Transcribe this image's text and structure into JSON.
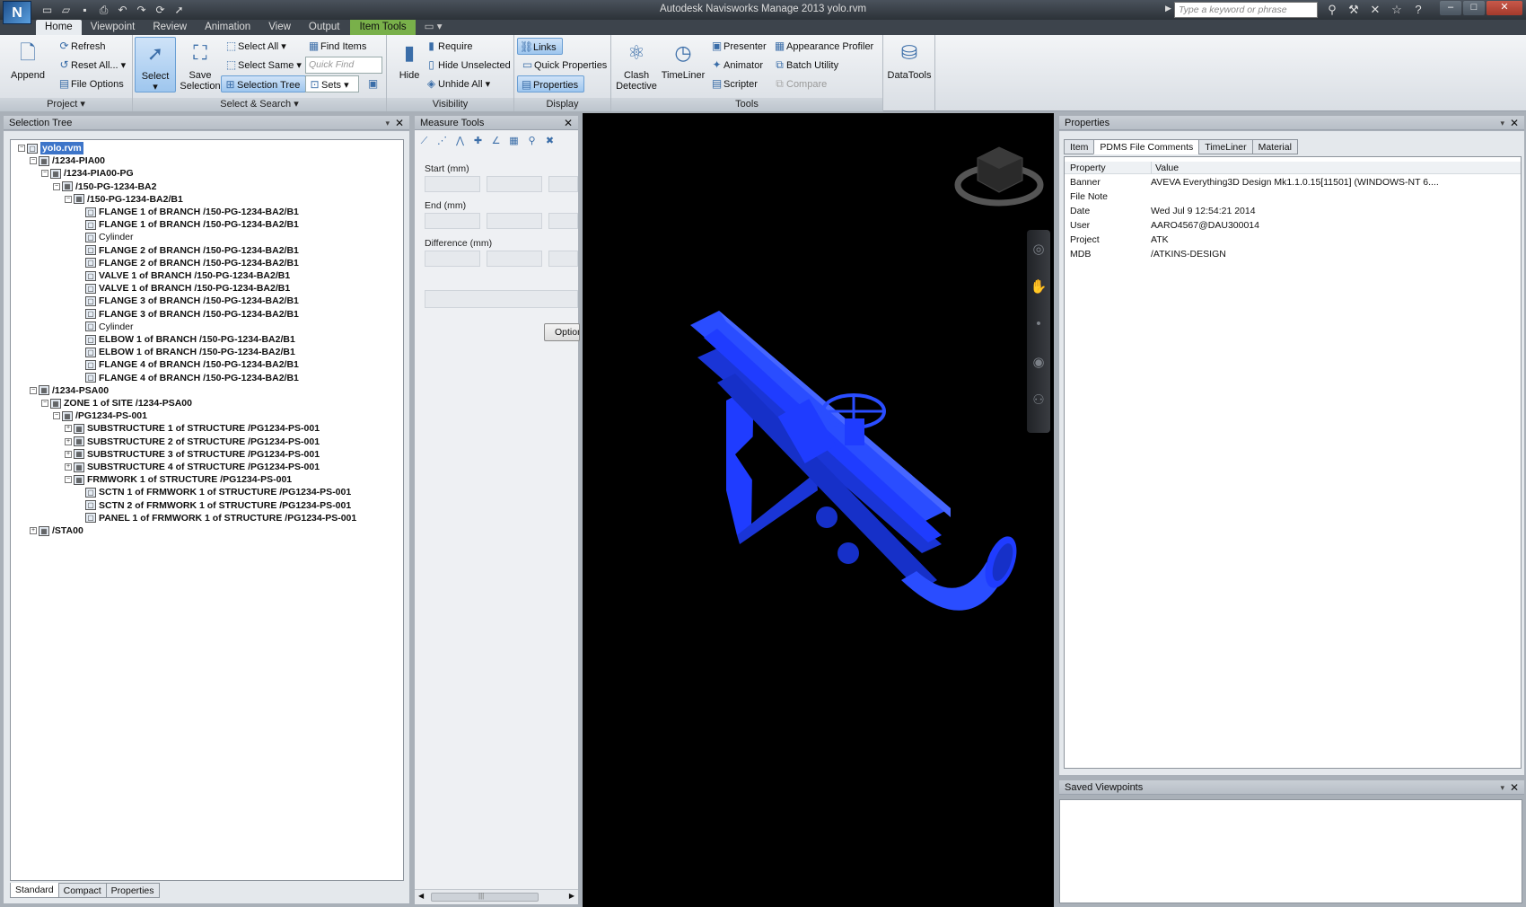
{
  "titlebar": {
    "title": "Autodesk Navisworks Manage 2013    yolo.rvm",
    "search_placeholder": "Type a keyword or phrase",
    "logo": "N",
    "quick_access_icons": [
      "new-icon",
      "open-icon",
      "save-icon",
      "print-icon",
      "undo-icon",
      "redo-icon",
      "refresh-icon",
      "select-icon"
    ],
    "window_buttons": [
      "–",
      "□",
      "✕"
    ]
  },
  "menu": {
    "tabs": [
      "Home",
      "Viewpoint",
      "Review",
      "Animation",
      "View",
      "Output",
      "Item Tools"
    ],
    "active": "Home",
    "context_tab": "Item Tools"
  },
  "ribbon": {
    "project": {
      "label": "Project",
      "append": "Append",
      "refresh": "Refresh",
      "reset_all": "Reset All...",
      "file_options": "File Options"
    },
    "select_search": {
      "label": "Select & Search",
      "select": "Select",
      "save_selection_1": "Save",
      "save_selection_2": "Selection",
      "select_all": "Select All",
      "select_same": "Select Same",
      "selection_tree": "Selection Tree",
      "find_items": "Find Items",
      "quick_find": "Quick Find",
      "sets": "Sets"
    },
    "visibility": {
      "label": "Visibility",
      "hide": "Hide",
      "require": "Require",
      "hide_unselected": "Hide Unselected",
      "unhide_all": "Unhide All"
    },
    "display": {
      "label": "Display",
      "links": "Links",
      "quick_properties": "Quick Properties",
      "properties": "Properties"
    },
    "tools": {
      "label": "Tools",
      "clash_1": "Clash",
      "clash_2": "Detective",
      "timeliner": "TimeLiner",
      "presenter": "Presenter",
      "animator": "Animator",
      "scripter": "Scripter",
      "appearance_profiler": "Appearance Profiler",
      "batch_utility": "Batch Utility",
      "compare": "Compare"
    },
    "datatools": {
      "label": "DataTools"
    }
  },
  "selection_tree": {
    "title": "Selection Tree",
    "rows": [
      {
        "indent": 0,
        "toggle": "−",
        "icon": "file",
        "label": "yolo.rvm",
        "selected": true
      },
      {
        "indent": 1,
        "toggle": "−",
        "icon": "group",
        "label": "/1234-PIA00"
      },
      {
        "indent": 2,
        "toggle": "−",
        "icon": "group",
        "label": "/1234-PIA00-PG"
      },
      {
        "indent": 3,
        "toggle": "−",
        "icon": "group",
        "label": "/150-PG-1234-BA2"
      },
      {
        "indent": 4,
        "toggle": "−",
        "icon": "group",
        "label": "/150-PG-1234-BA2/B1"
      },
      {
        "indent": 5,
        "toggle": "",
        "icon": "item",
        "label": "FLANGE 1 of BRANCH /150-PG-1234-BA2/B1"
      },
      {
        "indent": 5,
        "toggle": "",
        "icon": "item",
        "label": "FLANGE 1 of BRANCH /150-PG-1234-BA2/B1"
      },
      {
        "indent": 5,
        "toggle": "",
        "icon": "item",
        "label": "Cylinder",
        "plain": true
      },
      {
        "indent": 5,
        "toggle": "",
        "icon": "item",
        "label": "FLANGE 2 of BRANCH /150-PG-1234-BA2/B1"
      },
      {
        "indent": 5,
        "toggle": "",
        "icon": "item",
        "label": "FLANGE 2 of BRANCH /150-PG-1234-BA2/B1"
      },
      {
        "indent": 5,
        "toggle": "",
        "icon": "item",
        "label": "VALVE 1 of BRANCH /150-PG-1234-BA2/B1"
      },
      {
        "indent": 5,
        "toggle": "",
        "icon": "item",
        "label": "VALVE 1 of BRANCH /150-PG-1234-BA2/B1"
      },
      {
        "indent": 5,
        "toggle": "",
        "icon": "item",
        "label": "FLANGE 3 of BRANCH /150-PG-1234-BA2/B1"
      },
      {
        "indent": 5,
        "toggle": "",
        "icon": "item",
        "label": "FLANGE 3 of BRANCH /150-PG-1234-BA2/B1"
      },
      {
        "indent": 5,
        "toggle": "",
        "icon": "item",
        "label": "Cylinder",
        "plain": true
      },
      {
        "indent": 5,
        "toggle": "",
        "icon": "item",
        "label": "ELBOW 1 of BRANCH /150-PG-1234-BA2/B1"
      },
      {
        "indent": 5,
        "toggle": "",
        "icon": "item",
        "label": "ELBOW 1 of BRANCH /150-PG-1234-BA2/B1"
      },
      {
        "indent": 5,
        "toggle": "",
        "icon": "item",
        "label": "FLANGE 4 of BRANCH /150-PG-1234-BA2/B1"
      },
      {
        "indent": 5,
        "toggle": "",
        "icon": "item",
        "label": "FLANGE 4 of BRANCH /150-PG-1234-BA2/B1"
      },
      {
        "indent": 1,
        "toggle": "−",
        "icon": "group",
        "label": "/1234-PSA00"
      },
      {
        "indent": 2,
        "toggle": "−",
        "icon": "group",
        "label": "ZONE 1 of SITE /1234-PSA00"
      },
      {
        "indent": 3,
        "toggle": "−",
        "icon": "group",
        "label": "/PG1234-PS-001"
      },
      {
        "indent": 4,
        "toggle": "+",
        "icon": "group",
        "label": "SUBSTRUCTURE 1 of STRUCTURE /PG1234-PS-001"
      },
      {
        "indent": 4,
        "toggle": "+",
        "icon": "group",
        "label": "SUBSTRUCTURE 2 of STRUCTURE /PG1234-PS-001"
      },
      {
        "indent": 4,
        "toggle": "+",
        "icon": "group",
        "label": "SUBSTRUCTURE 3 of STRUCTURE /PG1234-PS-001"
      },
      {
        "indent": 4,
        "toggle": "+",
        "icon": "group",
        "label": "SUBSTRUCTURE 4 of STRUCTURE /PG1234-PS-001"
      },
      {
        "indent": 4,
        "toggle": "−",
        "icon": "group",
        "label": "FRMWORK 1 of STRUCTURE /PG1234-PS-001"
      },
      {
        "indent": 5,
        "toggle": "",
        "icon": "item",
        "label": "SCTN 1 of FRMWORK 1 of STRUCTURE /PG1234-PS-001"
      },
      {
        "indent": 5,
        "toggle": "",
        "icon": "item",
        "label": "SCTN 2 of FRMWORK 1 of STRUCTURE /PG1234-PS-001"
      },
      {
        "indent": 5,
        "toggle": "",
        "icon": "item",
        "label": "PANEL 1 of FRMWORK 1 of STRUCTURE /PG1234-PS-001"
      },
      {
        "indent": 1,
        "toggle": "+",
        "icon": "group",
        "label": "/STA00"
      }
    ],
    "bottom_tabs": [
      "Standard",
      "Compact",
      "Properties"
    ],
    "active_tab": "Standard"
  },
  "measure_tools": {
    "title": "Measure Tools",
    "start": "Start (mm)",
    "end": "End (mm)",
    "difference": "Difference (mm)",
    "options": "Options",
    "scroll_glyph": "|||"
  },
  "properties": {
    "title": "Properties",
    "tabs": [
      "Item",
      "PDMS File Comments",
      "TimeLiner",
      "Material"
    ],
    "active_tab": "PDMS File Comments",
    "col_property": "Property",
    "col_value": "Value",
    "rows": [
      {
        "name": "Banner",
        "value": "AVEVA Everything3D Design Mk1.1.0.15[11501]  (WINDOWS-NT 6...."
      },
      {
        "name": "File Note",
        "value": ""
      },
      {
        "name": "Date",
        "value": "Wed Jul  9 12:54:21 2014"
      },
      {
        "name": "User",
        "value": "AARO4567@DAU300014"
      },
      {
        "name": "Project",
        "value": "ATK"
      },
      {
        "name": "MDB",
        "value": "/ATKINS-DESIGN"
      }
    ]
  },
  "saved_viewpoints": {
    "title": "Saved Viewpoints"
  },
  "viewport": {
    "model_color": "#1f3cff",
    "background": "#000000"
  }
}
